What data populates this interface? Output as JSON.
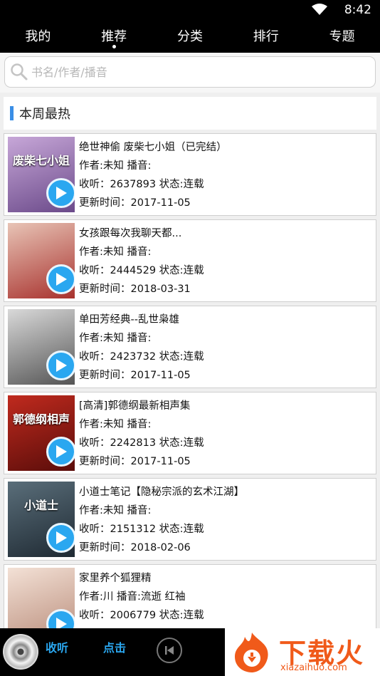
{
  "status_bar": {
    "time": "8:42"
  },
  "tabs": [
    {
      "label": "我的",
      "active": false
    },
    {
      "label": "推荐",
      "active": true
    },
    {
      "label": "分类",
      "active": false
    },
    {
      "label": "排行",
      "active": false
    },
    {
      "label": "专题",
      "active": false
    }
  ],
  "search": {
    "placeholder": "书名/作者/播音"
  },
  "section": {
    "title": "本周最热"
  },
  "books": [
    {
      "title": "绝世神偷 废柴七小姐（已完结）",
      "author": "作者:未知 播音:",
      "stats": "收听：2637893 状态:连载",
      "updated": "更新时间：2017-11-05",
      "cover_text": "废柴七小姐",
      "cover_colors": [
        "#c7a7d8",
        "#6b4a8a"
      ]
    },
    {
      "title": "女孩跟每次我聊天都...",
      "author": "作者:未知 播音:",
      "stats": "收听：2444529 状态:连载",
      "updated": "更新时间：2018-03-31",
      "cover_text": "",
      "cover_colors": [
        "#e8c4b6",
        "#a8322e"
      ]
    },
    {
      "title": "单田芳经典--乱世枭雄",
      "author": "作者:未知 播音:",
      "stats": "收听：2423732 状态:连载",
      "updated": "更新时间：2017-11-05",
      "cover_text": "",
      "cover_colors": [
        "#d9d9d9",
        "#555555"
      ]
    },
    {
      "title": "[高清]郭德纲最新相声集",
      "author": "作者:未知 播音:",
      "stats": "收听：2242813 状态:连载",
      "updated": "更新时间：2017-11-05",
      "cover_text": "郭德纲相声",
      "cover_colors": [
        "#c02a1e",
        "#5a0d0a"
      ]
    },
    {
      "title": "小道士笔记【隐秘宗派的玄术江湖】",
      "author": "作者:未知 播音:",
      "stats": "收听：2151312 状态:连载",
      "updated": "更新时间：2018-02-06",
      "cover_text": "小道士",
      "cover_colors": [
        "#5a6e7a",
        "#1f2a33"
      ]
    },
    {
      "title": "家里养个狐狸精",
      "author": "作者:川 播音:流逝 红袖",
      "stats": "收听：2006779 状态:连载",
      "updated": "",
      "cover_text": "",
      "cover_colors": [
        "#f3e1d6",
        "#b98c7a"
      ]
    }
  ],
  "player": {
    "text_a": "收听",
    "text_b": "点击"
  },
  "brand": {
    "name": "下载火",
    "url": "xiazaihuo.com"
  },
  "colors": {
    "accent": "#2aa7f0",
    "section_bar": "#3a8ee6",
    "brand": "#f05a1a"
  }
}
